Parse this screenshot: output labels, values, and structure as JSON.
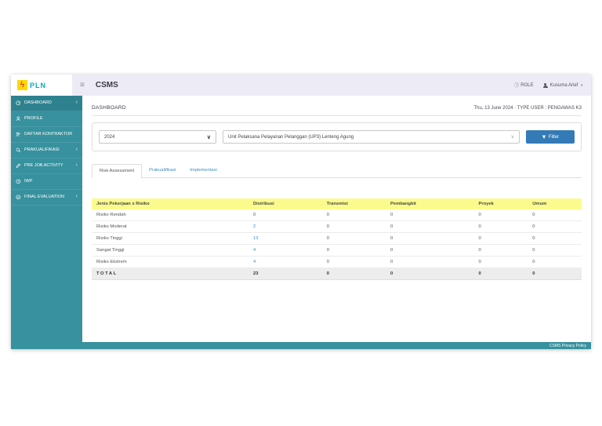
{
  "header": {
    "brand": "PLN",
    "app_title": "CSMS",
    "role_label": "ROLE",
    "user_name": "Kusuma Arief"
  },
  "icons": {
    "hamburger": "≡",
    "chevron_left": "‹",
    "chevron_down": "∨",
    "bolt": "ϟ",
    "role_badge": "ⓘ"
  },
  "sidebar": {
    "items": [
      {
        "label": "DASHBOARD",
        "icon": "dashboard-icon"
      },
      {
        "label": "PROFILE",
        "icon": "profile-icon"
      },
      {
        "label": "DAFTAR KONTRAKTOR",
        "icon": "contractors-icon"
      },
      {
        "label": "PRAKUALIFIKASI",
        "icon": "search-icon"
      },
      {
        "label": "PRE JOB ACTIVITY",
        "icon": "pencil-icon"
      },
      {
        "label": "IWP",
        "icon": "clock-icon"
      },
      {
        "label": "FINAL EVALUATION",
        "icon": "check-circle-icon"
      }
    ]
  },
  "page": {
    "title": "DASHBOARD",
    "date_info": "Thu, 13 June 2024 · TYPE USER : PENGAWAS K3"
  },
  "filters": {
    "year_value": "2024",
    "unit_value": "Unit Pelaksana Pelayanan Pelanggan (UP3) Lenteng Agung",
    "filter_button_label": "Filter"
  },
  "tabs": {
    "items": [
      {
        "label": "Risk Assessment"
      },
      {
        "label": "Prakualifikasi"
      },
      {
        "label": "Implementasi"
      }
    ]
  },
  "risk_table": {
    "type": "table",
    "columns": [
      "Jenis Pekerjaan x Risiko",
      "Distribusi",
      "Transmisi",
      "Pembangkit",
      "Proyek",
      "Umum"
    ],
    "rows": [
      {
        "label": "Risiko Rendah",
        "values": [
          "0",
          "0",
          "0",
          "0",
          "0"
        ]
      },
      {
        "label": "Risiko Moderat",
        "values": [
          "2",
          "0",
          "0",
          "0",
          "0"
        ]
      },
      {
        "label": "Risiko Tinggi",
        "values": [
          "13",
          "0",
          "0",
          "0",
          "0"
        ]
      },
      {
        "label": "Sangat Tinggi",
        "values": [
          "4",
          "0",
          "0",
          "0",
          "0"
        ]
      },
      {
        "label": "Risiko Ekstrem",
        "values": [
          "4",
          "0",
          "0",
          "0",
          "0"
        ]
      }
    ],
    "total_row": {
      "label": "TOTAL",
      "values": [
        "23",
        "0",
        "0",
        "0",
        "0"
      ]
    }
  },
  "footer": {
    "text": "CSMS Privacy Policy"
  },
  "colors": {
    "sidebar_teal": "#37919e",
    "topbar_lavender": "#edebf6",
    "table_header_yellow": "#fbfb8d",
    "link_blue": "#3c8dbc",
    "button_blue": "#337ab7",
    "brand_yellow": "#ffd800",
    "bolt_red": "#e03a3a",
    "brand_text_teal": "#00abc8"
  }
}
